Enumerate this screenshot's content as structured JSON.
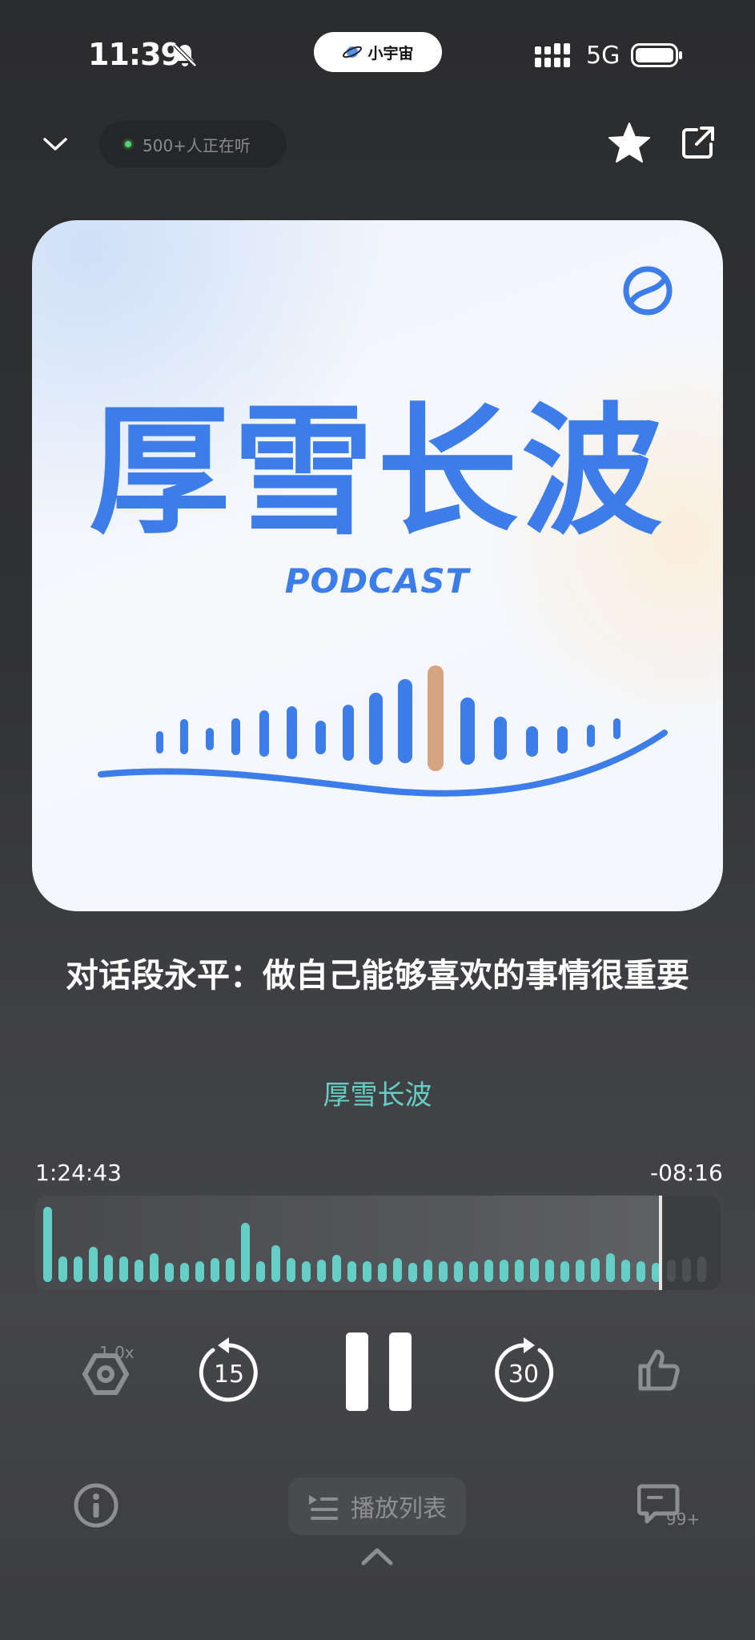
{
  "status_bar": {
    "time": "11:39",
    "island_label": "小宇宙",
    "network": "5G"
  },
  "top_bar": {
    "listeners": "500+人正在听"
  },
  "cover": {
    "show_name": "厚雪长波",
    "subtitle": "PODCAST"
  },
  "episode": {
    "title": "对话段永平：做自己能够喜欢的事情很重要",
    "podcast": "厚雪长波"
  },
  "progress": {
    "elapsed": "1:24:43",
    "remaining": "-08:16",
    "played_fraction": 0.912
  },
  "controls": {
    "speed": "1.0x",
    "skip_back": "15",
    "skip_forward": "30"
  },
  "bottom": {
    "playlist_label": "播放列表",
    "comments_badge": "99+"
  },
  "colors": {
    "accent": "#64cec7",
    "cover_blue": "#3d7de9",
    "cover_orange": "#d6a57f"
  }
}
